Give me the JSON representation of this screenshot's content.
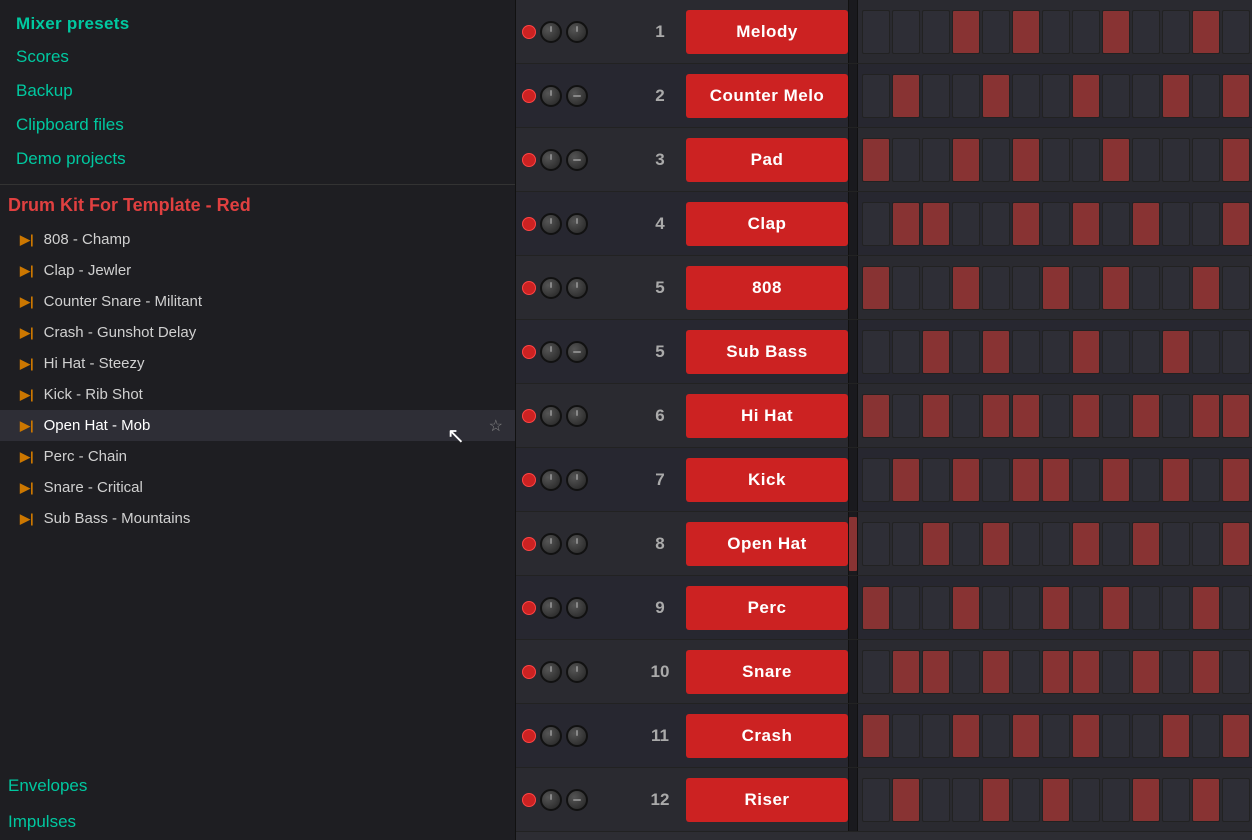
{
  "sidebar": {
    "top_items": [
      {
        "label": "Mixer presets",
        "color": "green"
      },
      {
        "label": "Scores",
        "color": "green"
      },
      {
        "label": "Backup",
        "color": "green"
      },
      {
        "label": "Clipboard files",
        "color": "green"
      },
      {
        "label": "Demo projects",
        "color": "green"
      }
    ],
    "active_folder": "Drum Kit For Template - Red",
    "sub_items": [
      {
        "label": "808 - Champ"
      },
      {
        "label": "Clap - Jewler"
      },
      {
        "label": "Counter Snare - Militant"
      },
      {
        "label": "Crash - Gunshot Delay"
      },
      {
        "label": "Hi Hat - Steezy"
      },
      {
        "label": "Kick - Rib Shot"
      },
      {
        "label": "Open Hat - Mob",
        "active": true,
        "star": true
      },
      {
        "label": "Perc - Chain"
      },
      {
        "label": "Snare - Critical"
      },
      {
        "label": "Sub Bass - Mountains"
      }
    ],
    "bottom_items": [
      {
        "label": "Envelopes",
        "color": "green"
      },
      {
        "label": "Impulses",
        "color": "green"
      }
    ]
  },
  "mixer": {
    "tracks": [
      {
        "number": "1",
        "label": "Melody"
      },
      {
        "number": "2",
        "label": "Counter Melo"
      },
      {
        "number": "3",
        "label": "Pad"
      },
      {
        "number": "4",
        "label": "Clap"
      },
      {
        "number": "5",
        "label": "808"
      },
      {
        "number": "5",
        "label": "Sub Bass"
      },
      {
        "number": "6",
        "label": "Hi Hat"
      },
      {
        "number": "7",
        "label": "Kick"
      },
      {
        "number": "8",
        "label": "Open Hat"
      },
      {
        "number": "9",
        "label": "Perc"
      },
      {
        "number": "10",
        "label": "Snare"
      },
      {
        "number": "11",
        "label": "Crash"
      },
      {
        "number": "12",
        "label": "Riser"
      }
    ]
  }
}
